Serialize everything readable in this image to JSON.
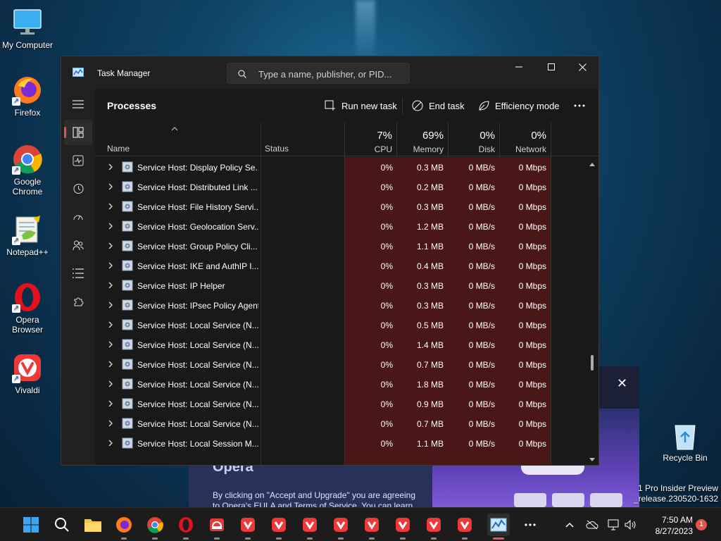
{
  "desktop": {
    "icons": [
      {
        "label": "My Computer"
      },
      {
        "label": "Firefox"
      },
      {
        "label": "Google Chrome"
      },
      {
        "label": "Notepad++"
      },
      {
        "label": "Opera Browser"
      },
      {
        "label": "Vivaldi"
      }
    ],
    "recycle_bin": "Recycle Bin",
    "insider_line1": "1 Pro Insider Preview",
    "insider_line2": "_release.230520-1632"
  },
  "background_window": {
    "heading": "Opera",
    "body_line1": "By clicking on \"Accept and Upgrade\" you are agreeing",
    "body_line2": "to Opera's EULA and Terms of Service. You can learn"
  },
  "window": {
    "title": "Task Manager",
    "search_placeholder": "Type a name, publisher, or PID..."
  },
  "toolbar": {
    "page_title": "Processes",
    "run_new_task": "Run new task",
    "end_task": "End task",
    "efficiency_mode": "Efficiency mode"
  },
  "columns": {
    "name": "Name",
    "status": "Status",
    "cpu_pct": "7%",
    "cpu": "CPU",
    "memory_pct": "69%",
    "memory": "Memory",
    "disk_pct": "0%",
    "disk": "Disk",
    "network_pct": "0%",
    "network": "Network"
  },
  "processes": [
    {
      "name": "Service Host: Display Policy Se...",
      "cpu": "0%",
      "memory": "0.3 MB",
      "disk": "0 MB/s",
      "network": "0 Mbps"
    },
    {
      "name": "Service Host: Distributed Link ...",
      "cpu": "0%",
      "memory": "0.2 MB",
      "disk": "0 MB/s",
      "network": "0 Mbps"
    },
    {
      "name": "Service Host: File History Servi...",
      "cpu": "0%",
      "memory": "0.3 MB",
      "disk": "0 MB/s",
      "network": "0 Mbps"
    },
    {
      "name": "Service Host: Geolocation Serv...",
      "cpu": "0%",
      "memory": "1.2 MB",
      "disk": "0 MB/s",
      "network": "0 Mbps"
    },
    {
      "name": "Service Host: Group Policy Cli...",
      "cpu": "0%",
      "memory": "1.1 MB",
      "disk": "0 MB/s",
      "network": "0 Mbps"
    },
    {
      "name": "Service Host: IKE and AuthIP I...",
      "cpu": "0%",
      "memory": "0.4 MB",
      "disk": "0 MB/s",
      "network": "0 Mbps"
    },
    {
      "name": "Service Host: IP Helper",
      "cpu": "0%",
      "memory": "0.3 MB",
      "disk": "0 MB/s",
      "network": "0 Mbps"
    },
    {
      "name": "Service Host: IPsec Policy Agent",
      "cpu": "0%",
      "memory": "0.3 MB",
      "disk": "0 MB/s",
      "network": "0 Mbps"
    },
    {
      "name": "Service Host: Local Service (N...",
      "cpu": "0%",
      "memory": "0.5 MB",
      "disk": "0 MB/s",
      "network": "0 Mbps"
    },
    {
      "name": "Service Host: Local Service (N...",
      "cpu": "0%",
      "memory": "1.4 MB",
      "disk": "0 MB/s",
      "network": "0 Mbps"
    },
    {
      "name": "Service Host: Local Service (N...",
      "cpu": "0%",
      "memory": "0.7 MB",
      "disk": "0 MB/s",
      "network": "0 Mbps"
    },
    {
      "name": "Service Host: Local Service (N...",
      "cpu": "0%",
      "memory": "1.8 MB",
      "disk": "0 MB/s",
      "network": "0 Mbps"
    },
    {
      "name": "Service Host: Local Service (N...",
      "cpu": "0%",
      "memory": "0.9 MB",
      "disk": "0 MB/s",
      "network": "0 Mbps"
    },
    {
      "name": "Service Host: Local Service (N...",
      "cpu": "0%",
      "memory": "0.7 MB",
      "disk": "0 MB/s",
      "network": "0 Mbps"
    },
    {
      "name": "Service Host: Local Session M...",
      "cpu": "0%",
      "memory": "1.1 MB",
      "disk": "0 MB/s",
      "network": "0 Mbps"
    }
  ],
  "taskbar": {
    "time": "7:50 AM",
    "date": "8/27/2023",
    "notifications": "1"
  },
  "colors": {
    "accent": "#e6534c",
    "heat": "#4a1717",
    "window_bg": "#202020"
  }
}
